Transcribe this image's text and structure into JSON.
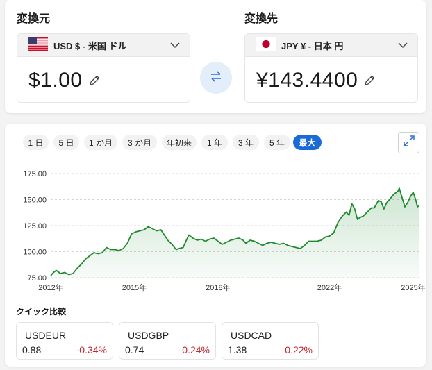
{
  "converter": {
    "from_label": "変換元",
    "to_label": "変換先",
    "from_currency": "USD $ - 米国 ドル",
    "to_currency": "JPY ¥ - 日本 円",
    "from_amount": "$1.00",
    "to_amount": "¥143.4400",
    "icons": {
      "from_flag": "us-flag-icon",
      "to_flag": "japan-flag-icon",
      "dropdown": "chevron-down-icon",
      "edit": "pencil-icon",
      "swap": "swap-arrows-icon"
    },
    "colors": {
      "swap_bg": "#e4eefa",
      "swap_icon": "#2a6fd6"
    }
  },
  "ranges": {
    "items": [
      "1 日",
      "5 日",
      "1 か月",
      "3 か月",
      "年初来",
      "1 年",
      "3 年",
      "5 年",
      "最大"
    ],
    "active": "最大",
    "active_color": "#1a6ad8"
  },
  "expand_icon": "expand-arrows-icon",
  "chart_data": {
    "type": "area",
    "title": "",
    "xlabel": "",
    "ylabel": "",
    "x_ticks": [
      "2012年",
      "2015年",
      "2018年",
      "2022年",
      "2025年"
    ],
    "y_ticks": [
      "175.00",
      "150.00",
      "125.00",
      "100.00",
      "75.00"
    ],
    "ylim": [
      75,
      175
    ],
    "xlim": [
      2012.0,
      2025.2
    ],
    "grid": true,
    "line_color": "#1d8a2e",
    "series": [
      {
        "points": [
          [
            2012.0,
            77
          ],
          [
            2012.1,
            80
          ],
          [
            2012.2,
            82
          ],
          [
            2012.35,
            79
          ],
          [
            2012.5,
            80
          ],
          [
            2012.65,
            78
          ],
          [
            2012.8,
            79
          ],
          [
            2012.95,
            84
          ],
          [
            2013.1,
            88
          ],
          [
            2013.25,
            93
          ],
          [
            2013.4,
            96
          ],
          [
            2013.55,
            99
          ],
          [
            2013.7,
            98
          ],
          [
            2013.85,
            99
          ],
          [
            2014.0,
            104
          ],
          [
            2014.15,
            102
          ],
          [
            2014.3,
            102
          ],
          [
            2014.45,
            101
          ],
          [
            2014.6,
            103
          ],
          [
            2014.75,
            108
          ],
          [
            2014.9,
            117
          ],
          [
            2015.05,
            119
          ],
          [
            2015.2,
            120
          ],
          [
            2015.35,
            121
          ],
          [
            2015.5,
            124
          ],
          [
            2015.65,
            122
          ],
          [
            2015.8,
            120
          ],
          [
            2015.95,
            121
          ],
          [
            2016.1,
            115
          ],
          [
            2016.2,
            111
          ],
          [
            2016.35,
            107
          ],
          [
            2016.5,
            102
          ],
          [
            2016.6,
            103
          ],
          [
            2016.75,
            104
          ],
          [
            2016.85,
            110
          ],
          [
            2016.95,
            116
          ],
          [
            2017.1,
            113
          ],
          [
            2017.25,
            111
          ],
          [
            2017.4,
            112
          ],
          [
            2017.55,
            110
          ],
          [
            2017.7,
            112
          ],
          [
            2017.85,
            113
          ],
          [
            2018.0,
            110
          ],
          [
            2018.15,
            107
          ],
          [
            2018.3,
            109
          ],
          [
            2018.45,
            111
          ],
          [
            2018.6,
            112
          ],
          [
            2018.75,
            113
          ],
          [
            2018.9,
            111
          ],
          [
            2019.0,
            108
          ],
          [
            2019.15,
            111
          ],
          [
            2019.3,
            110
          ],
          [
            2019.45,
            108
          ],
          [
            2019.6,
            106
          ],
          [
            2019.75,
            108
          ],
          [
            2019.9,
            109
          ],
          [
            2020.05,
            108
          ],
          [
            2020.2,
            107
          ],
          [
            2020.35,
            108
          ],
          [
            2020.5,
            106
          ],
          [
            2020.65,
            105
          ],
          [
            2020.8,
            104
          ],
          [
            2020.95,
            103
          ],
          [
            2021.1,
            106
          ],
          [
            2021.25,
            110
          ],
          [
            2021.4,
            110
          ],
          [
            2021.55,
            110
          ],
          [
            2021.7,
            111
          ],
          [
            2021.85,
            114
          ],
          [
            2022.0,
            115
          ],
          [
            2022.15,
            118
          ],
          [
            2022.3,
            128
          ],
          [
            2022.45,
            134
          ],
          [
            2022.6,
            138
          ],
          [
            2022.7,
            135
          ],
          [
            2022.8,
            146
          ],
          [
            2022.9,
            141
          ],
          [
            2023.0,
            131
          ],
          [
            2023.1,
            133
          ],
          [
            2023.2,
            134
          ],
          [
            2023.35,
            138
          ],
          [
            2023.5,
            142
          ],
          [
            2023.6,
            142
          ],
          [
            2023.75,
            149
          ],
          [
            2023.85,
            148
          ],
          [
            2023.95,
            141
          ],
          [
            2024.05,
            147
          ],
          [
            2024.15,
            150
          ],
          [
            2024.3,
            155
          ],
          [
            2024.45,
            158
          ],
          [
            2024.5,
            161
          ],
          [
            2024.6,
            152
          ],
          [
            2024.7,
            143
          ],
          [
            2024.8,
            147
          ],
          [
            2024.9,
            153
          ],
          [
            2025.0,
            157
          ],
          [
            2025.1,
            149
          ],
          [
            2025.15,
            143
          ],
          [
            2025.2,
            144
          ]
        ]
      }
    ]
  },
  "quick": {
    "title": "クイック比較",
    "items": [
      {
        "pair": "USDEUR",
        "rate": "0.88",
        "change": "-0.34%"
      },
      {
        "pair": "USDGBP",
        "rate": "0.74",
        "change": "-0.24%"
      },
      {
        "pair": "USDCAD",
        "rate": "1.38",
        "change": "-0.22%"
      }
    ],
    "negative_color": "#c4262e"
  }
}
